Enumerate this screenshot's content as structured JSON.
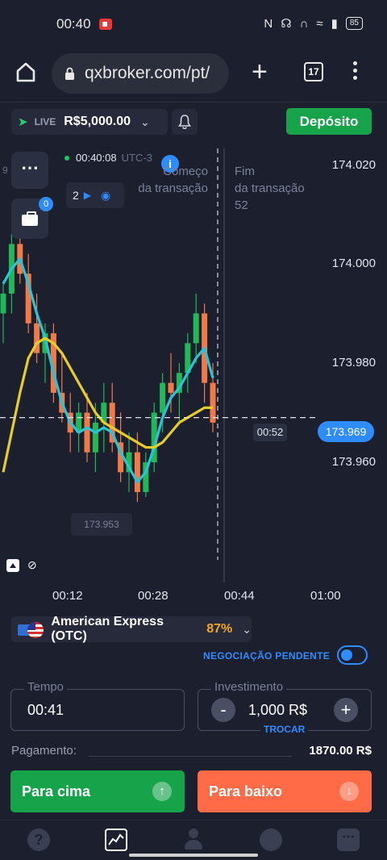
{
  "status_bar": {
    "time": "00:40",
    "battery": "85",
    "icons": [
      "nfc-icon",
      "headset-icon",
      "vibrate-icon",
      "wifi-icon",
      "signal-icon",
      "battery-icon"
    ]
  },
  "browser": {
    "url": "qxbroker.com/pt/",
    "tab_count": "17"
  },
  "account": {
    "mode": "LIVE",
    "balance": "R$5,000.00",
    "deposit_label": "Depósito"
  },
  "chart_panel": {
    "clock": "00:40:08",
    "timezone": "UTC-3",
    "watchers": "2",
    "start_label_line1": "Começo",
    "start_label_line2": "da transação",
    "end_label_line1": "Fim",
    "end_label_line2": "da transação",
    "end_label_line3": "52",
    "open_trades_badge": "0",
    "countdown": "00:52",
    "current_price": "173.969",
    "low_price_tag": "173.953",
    "corner_digit": "9"
  },
  "chart_data": {
    "type": "candlestick",
    "y_ticks": [
      "174.020",
      "174.000",
      "173.980",
      "173.960"
    ],
    "x_ticks": [
      "00:12",
      "00:28",
      "00:44",
      "01:00"
    ],
    "ylim": [
      173.95,
      174.024
    ],
    "current_price": 173.969,
    "candles": [
      [
        173.99,
        173.996,
        173.984,
        173.994
      ],
      [
        173.994,
        174.006,
        173.99,
        174.004
      ],
      [
        174.004,
        174.01,
        173.996,
        173.998
      ],
      [
        173.998,
        174.002,
        173.986,
        173.988
      ],
      [
        173.988,
        173.994,
        173.98,
        173.982
      ],
      [
        173.982,
        173.988,
        173.976,
        173.986
      ],
      [
        173.986,
        173.988,
        173.972,
        173.974
      ],
      [
        173.974,
        173.982,
        173.968,
        173.97
      ],
      [
        173.97,
        173.974,
        173.962,
        173.966
      ],
      [
        173.966,
        173.972,
        173.962,
        173.97
      ],
      [
        173.97,
        173.974,
        173.96,
        173.962
      ],
      [
        173.962,
        173.972,
        173.958,
        173.968
      ],
      [
        173.968,
        173.976,
        173.962,
        173.972
      ],
      [
        173.972,
        173.976,
        173.962,
        173.964
      ],
      [
        173.964,
        173.97,
        173.956,
        173.958
      ],
      [
        173.958,
        173.966,
        173.954,
        173.962
      ],
      [
        173.962,
        173.966,
        173.952,
        173.954
      ],
      [
        173.954,
        173.962,
        173.953,
        173.96
      ],
      [
        173.96,
        173.972,
        173.958,
        173.97
      ],
      [
        173.97,
        173.978,
        173.966,
        173.976
      ],
      [
        173.976,
        173.982,
        173.97,
        173.974
      ],
      [
        173.974,
        173.98,
        173.968,
        173.978
      ],
      [
        173.978,
        173.986,
        173.974,
        173.984
      ],
      [
        173.984,
        173.994,
        173.98,
        173.99
      ],
      [
        173.99,
        173.992,
        173.972,
        173.976
      ],
      [
        173.976,
        173.98,
        173.966,
        173.968
      ]
    ],
    "series": [
      {
        "name": "",
        "color": "#29c5d6",
        "values": [
          173.996,
          173.999,
          174.001,
          173.996,
          173.99,
          173.985,
          173.978,
          173.972,
          173.968,
          173.966,
          173.967,
          173.966,
          173.967,
          173.966,
          173.962,
          173.959,
          173.956,
          173.958,
          173.963,
          173.969,
          173.973,
          173.975,
          173.978,
          173.981,
          173.983,
          173.977
        ]
      },
      {
        "name": "",
        "color": "#e8cc2a",
        "values": [
          173.958,
          173.966,
          173.974,
          173.981,
          173.984,
          173.985,
          173.984,
          173.982,
          173.979,
          173.976,
          173.973,
          173.97,
          173.968,
          173.967,
          173.966,
          173.965,
          173.964,
          173.963,
          173.963,
          173.964,
          173.966,
          173.968,
          173.969,
          173.97,
          173.971,
          173.971
        ]
      }
    ]
  },
  "asset": {
    "name": "American Express (OTC)",
    "payout_pct": "87%"
  },
  "pending": {
    "label": "NEGOCIAÇÃO PENDENTE"
  },
  "trade_form": {
    "time_label": "Tempo",
    "time_value": "00:41",
    "investment_label": "Investimento",
    "investment_value": "1,000 R$",
    "minus": "-",
    "plus": "+",
    "switch_label": "TROCAR",
    "payout_label": "Pagamento:",
    "payout_value": "1870.00 R$",
    "up_label": "Para cima",
    "down_label": "Para baixo"
  },
  "bottom_nav": [
    "help-icon",
    "chart-icon",
    "user-icon",
    "settings-icon",
    "more-icon"
  ]
}
